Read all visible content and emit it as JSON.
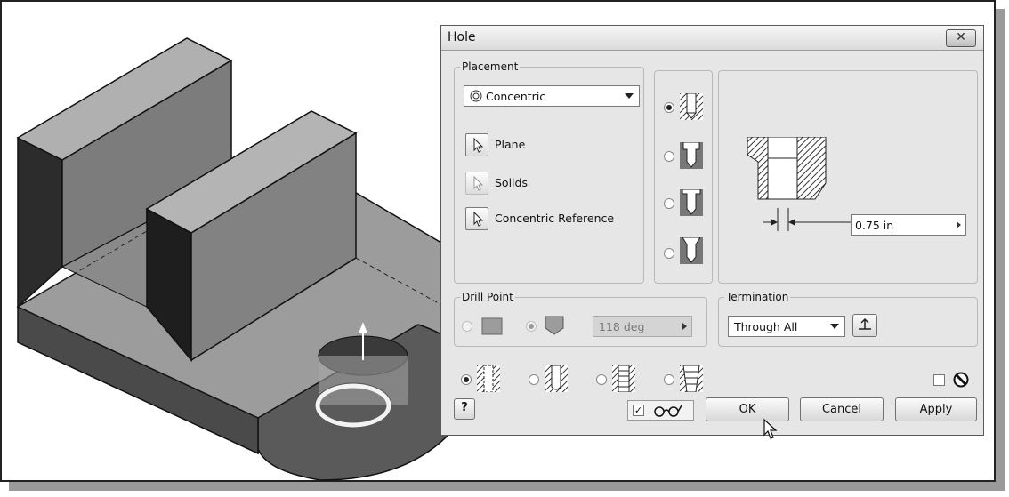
{
  "dialog": {
    "title": "Hole",
    "close_icon": "close-icon"
  },
  "placement": {
    "label": "Placement",
    "selected": "Concentric",
    "selectors": [
      {
        "label": "Plane",
        "icon": "cursor-arrow-icon",
        "enabled": true
      },
      {
        "label": "Solids",
        "icon": "cursor-arrow-icon",
        "enabled": false
      },
      {
        "label": "Concentric Reference",
        "icon": "cursor-arrow-icon",
        "enabled": true
      }
    ]
  },
  "hole_types": {
    "options": [
      "drill-hole-icon",
      "counterbore-hole-icon",
      "spotface-hole-icon",
      "countersink-hole-icon"
    ],
    "selected_index": 0
  },
  "preview": {
    "diameter_value": "0.75 in"
  },
  "drill_point": {
    "label": "Drill Point",
    "options": [
      "flat-point-icon",
      "angle-point-icon"
    ],
    "selected_index": 1,
    "angle_value": "118 deg"
  },
  "termination": {
    "label": "Termination",
    "selected": "Through All",
    "flip_icon": "flip-direction-icon"
  },
  "thread_types": {
    "options": [
      "simple-hole-icon",
      "clearance-hole-icon",
      "tapped-hole-icon",
      "taper-tapped-hole-icon"
    ],
    "selected_index": 0
  },
  "options_checkbox": {
    "checked": false,
    "icon": "ismetric-icon"
  },
  "footer": {
    "help_icon": "help-icon",
    "preview_checked": true,
    "preview_icon": "glasses-icon",
    "ok_label": "OK",
    "cancel_label": "Cancel",
    "apply_label": "Apply"
  },
  "colors": {
    "dialog_bg": "#e6e6e6",
    "model_top": "#9a9a9a",
    "model_front": "#5e5e5e",
    "model_side": "#2e2e2e"
  }
}
